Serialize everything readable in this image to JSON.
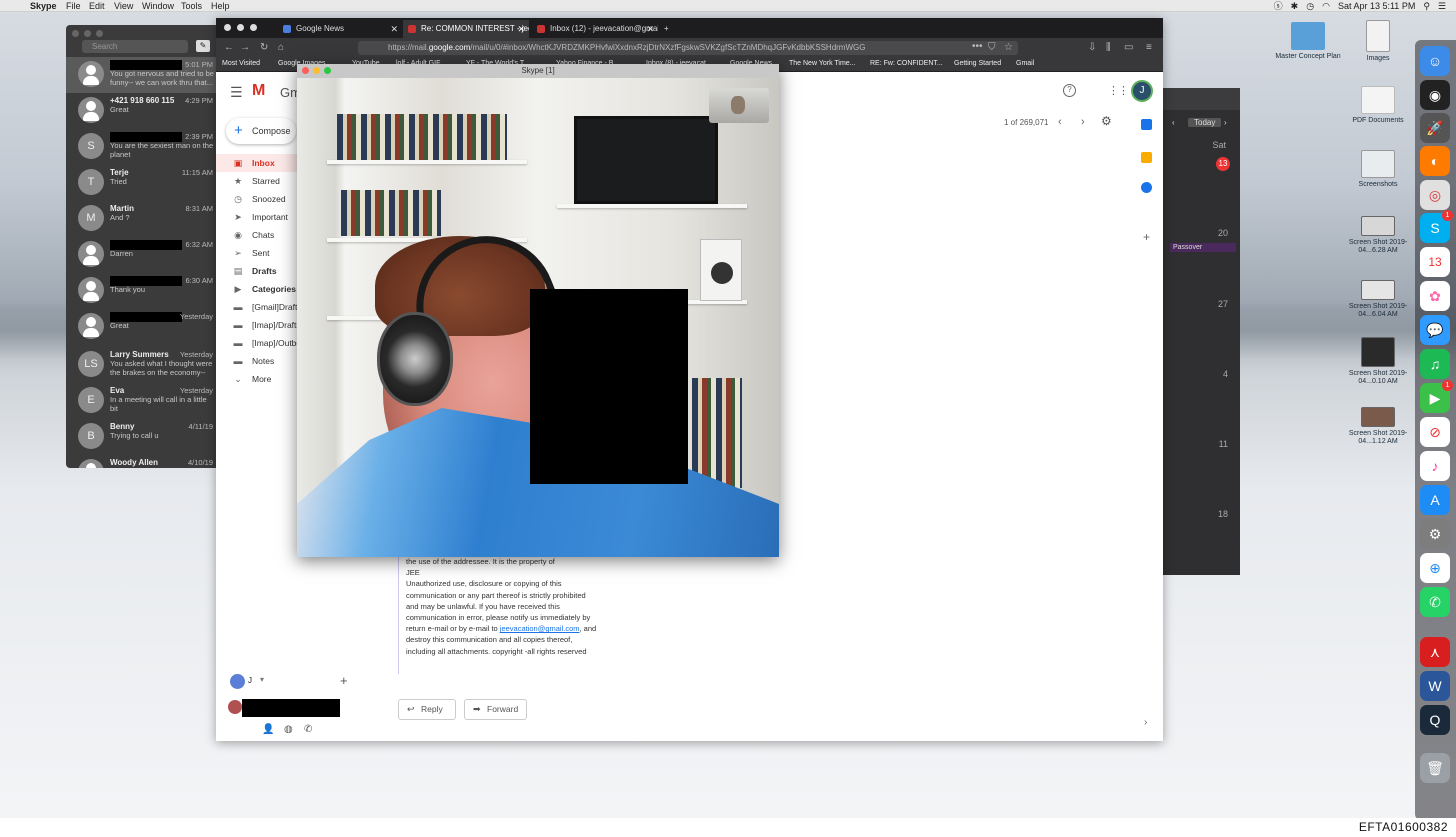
{
  "menubar": {
    "app": "Skype",
    "items": [
      "File",
      "Edit",
      "View",
      "Window",
      "Tools",
      "Help"
    ],
    "clock": "Sat Apr 13  5:11 PM"
  },
  "skype": {
    "search_placeholder": "Search",
    "conversations": [
      {
        "name": "",
        "time": "5:01 PM",
        "message": "You got nervous and tried to be funny-- we can work thru that...",
        "avatar": "",
        "redacted": true
      },
      {
        "name": "+421 918 660 115",
        "time": "4:29 PM",
        "message": "Great",
        "avatar": ""
      },
      {
        "name": "",
        "time": "2:39 PM",
        "message": "You are the sexiest man on the planet",
        "avatar": "S",
        "redacted": true
      },
      {
        "name": "Terje",
        "time": "11:15 AM",
        "message": "Tried",
        "avatar": "T"
      },
      {
        "name": "Martin",
        "time": "8:31 AM",
        "message": "And ?",
        "avatar": "M"
      },
      {
        "name": "",
        "time": "6:32 AM",
        "message": "Darren",
        "avatar": "",
        "redacted": true
      },
      {
        "name": "",
        "time": "6:30 AM",
        "message": "Thank you",
        "avatar": "",
        "redacted": true
      },
      {
        "name": "",
        "time": "Yesterday",
        "message": "Great",
        "avatar": "",
        "redacted": true
      },
      {
        "name": "Larry Summers",
        "time": "Yesterday",
        "message": "You asked what I thought were the brakes on the economy-- gr...",
        "avatar": "LS"
      },
      {
        "name": "Eva",
        "time": "Yesterday",
        "message": "In a meeting will call in a little bit",
        "avatar": "E"
      },
      {
        "name": "Benny",
        "time": "4/11/19",
        "message": "Trying to call u",
        "avatar": "B"
      },
      {
        "name": "Woody Allen",
        "time": "4/10/19",
        "message": "",
        "avatar": ""
      }
    ]
  },
  "browser": {
    "tabs": [
      {
        "title": "Google News"
      },
      {
        "title": "Re: COMMON INTEREST - jeev"
      },
      {
        "title": "Inbox (12) - jeevacation@gmai"
      }
    ],
    "url_prefix": "https://mail.",
    "url_domain": "google.com",
    "url_rest": "/mail/u/0/#inbox/WhctKJVRDZMKPHvfwlXxdnxRzjDtrNXzfFgskwSVKZgfScTZnMDhqJGFvKdbbKSSHdrmWGG",
    "bookmarks": [
      "Most Visited",
      "Google Images",
      "YouTube",
      "lolf - Adult GIF...",
      "YF - The World's T...",
      "Yahoo Finance - B...",
      "Inbox (8) - jeevacat...",
      "Google News",
      "The New York Time...",
      "RE: Fw: CONFIDENT...",
      "Getting Started",
      "Gmail"
    ]
  },
  "gmail": {
    "logo_text": "Gmail",
    "compose": "Compose",
    "labels": [
      "Inbox",
      "Starred",
      "Snoozed",
      "Important",
      "Chats",
      "Sent",
      "Drafts",
      "Categories",
      "[Gmail]Drafts",
      "[Imap]/Drafts",
      "[Imap]/Outbox",
      "Notes",
      "More"
    ],
    "paging": "1 of 269,071",
    "avatar_letter": "J",
    "account_letter": "J",
    "body_lines": [
      "the use of the addressee. It is the property of",
      "JEE",
      "Unauthorized use, disclosure or copying of this",
      "communication or any part thereof is strictly prohibited",
      "and may be unlawful. If you have received this",
      "communication in error, please notify us immediately by"
    ],
    "body_pre_link": "return e-mail or by e-mail to ",
    "body_link": "jeevacation@gmail.com",
    "body_post_link": ", and",
    "body_tail": [
      "destroy this communication and all copies thereof,",
      "including all attachments. copyright -all rights reserved"
    ],
    "reply": "Reply",
    "forward": "Forward"
  },
  "call_window": {
    "title": "Skype [1]"
  },
  "calendar": {
    "today": "Today",
    "weekday": "Sat",
    "days": [
      "13",
      "20",
      "27",
      "4",
      "11",
      "18"
    ],
    "event": "Passover"
  },
  "desktop_icons": [
    {
      "label": "Master Concept Plan"
    },
    {
      "label": "Images"
    },
    {
      "label": "PDF Documents"
    },
    {
      "label": "Screenshots"
    },
    {
      "label": "Screen Shot 2019-04...6.28 AM"
    },
    {
      "label": "Screen Shot 2019-04...6.04 AM"
    },
    {
      "label": "Screen Shot 2019-04...0.10 AM"
    },
    {
      "label": "Screen Shot 2019-04...1.12 AM"
    }
  ],
  "dock_badges": {
    "skype": "1",
    "facetime": "1"
  },
  "footer_id": "EFTA01600382"
}
